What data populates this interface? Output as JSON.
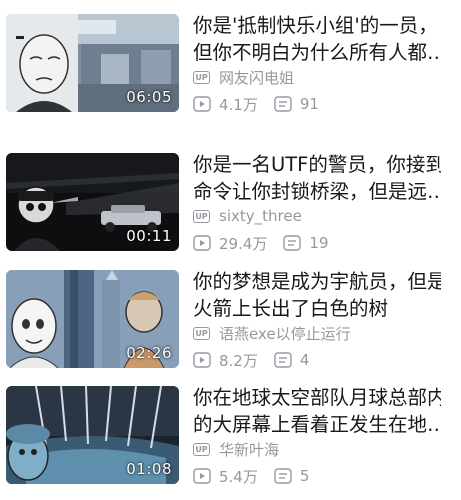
{
  "videos": [
    {
      "title_line1": "你是'抵制快乐小组'的一员，",
      "title_line2": "但你不明白为什么所有人都…",
      "uploader": "网友闪电姐",
      "views": "4.1万",
      "comments": "91",
      "duration": "06:05"
    },
    {
      "title_line1": "你是一名UTF的警员，你接到",
      "title_line2": "命令让你封锁桥梁，但是远…",
      "uploader": "sixty_three",
      "views": "29.4万",
      "comments": "19",
      "duration": "00:11"
    },
    {
      "title_line1": "你的梦想是成为宇航员，但是",
      "title_line2": "火箭上长出了白色的树",
      "uploader": "语燕exe以停止运行",
      "views": "8.2万",
      "comments": "4",
      "duration": "02:26"
    },
    {
      "title_line1": "你在地球太空部队月球总部内",
      "title_line2": "的大屏幕上看着正发生在地…",
      "uploader": "华新叶海",
      "views": "5.4万",
      "comments": "5",
      "duration": "01:08"
    }
  ],
  "badge_label": "UP",
  "icons": {
    "uploader": "up-badge-icon",
    "views": "play-count-icon",
    "comments": "comment-count-icon"
  },
  "colors": {
    "title": "#18191c",
    "meta": "#9499a0",
    "background": "#ffffff"
  }
}
